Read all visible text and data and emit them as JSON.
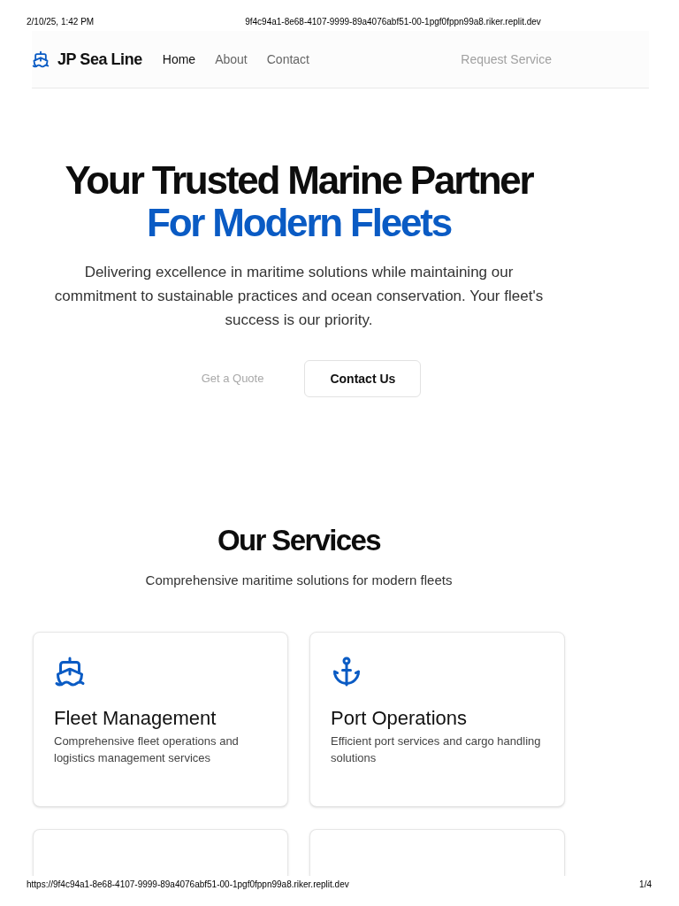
{
  "print_header": {
    "date": "2/10/25, 1:42 PM",
    "url": "9f4c94a1-8e68-4107-9999-89a4076abf51-00-1pgf0fppn99a8.riker.replit.dev"
  },
  "nav": {
    "brand": "JP Sea Line",
    "links": [
      {
        "label": "Home",
        "selected": true
      },
      {
        "label": "About",
        "selected": false
      },
      {
        "label": "Contact",
        "selected": false
      }
    ],
    "cta": "Request Service"
  },
  "hero": {
    "title": "Your Trusted Marine Partner",
    "title_highlight": "For Modern Fleets",
    "description": "Delivering excellence in maritime solutions while maintaining our commitment to sustainable practices and ocean conservation. Your fleet's success is our priority.",
    "buttons": [
      {
        "label": "Get a Quote",
        "kind": "ghost"
      },
      {
        "label": "Contact Us",
        "kind": "outline"
      }
    ]
  },
  "services": {
    "title": "Our Services",
    "subtitle": "Comprehensive maritime solutions for modern fleets",
    "cards": [
      {
        "kind": "full",
        "title": "Fleet Management",
        "description": "Comprehensive fleet operations and logistics management services"
      },
      {
        "kind": "full",
        "title": "Port Operations",
        "description": "Efficient port services and cargo handling solutions"
      },
      {
        "kind": "cut_off"
      },
      {
        "kind": "cut_off"
      }
    ]
  },
  "print_footer": {
    "url": "https://9f4c94a1-8e68-4107-9999-89a4076abf51-00-1pgf0fppn99a8.riker.replit.dev",
    "page": "1/4"
  }
}
